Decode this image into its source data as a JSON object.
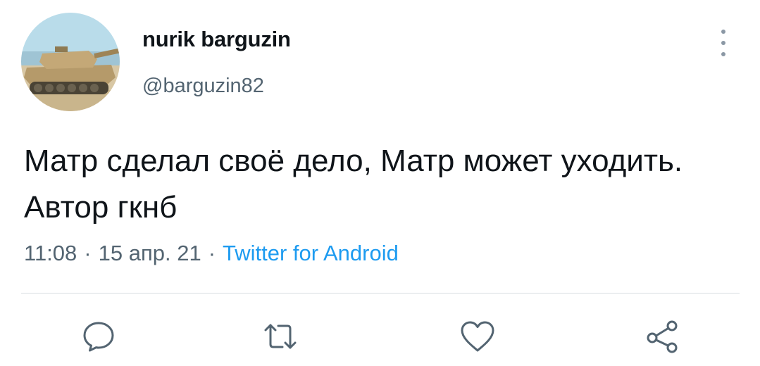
{
  "author": {
    "display_name": "nurik barguzin",
    "handle": "@barguzin82",
    "avatar_icon": "tank-photo-avatar"
  },
  "tweet": {
    "text": "Матр сделал своё дело, Матр может уходить. Автор гкнб",
    "time": "11:08",
    "date": "15 апр. 21",
    "separator": "·",
    "source": "Twitter for Android"
  },
  "menu": {
    "icon": "more-vertical-icon"
  },
  "actions": [
    {
      "name": "reply",
      "icon": "reply-icon"
    },
    {
      "name": "retweet",
      "icon": "retweet-icon"
    },
    {
      "name": "like",
      "icon": "heart-icon"
    },
    {
      "name": "share",
      "icon": "share-icon"
    }
  ],
  "colors": {
    "text": "#0f1419",
    "secondary": "#536471",
    "accent": "#1d9bf0",
    "icon": "#536471"
  }
}
